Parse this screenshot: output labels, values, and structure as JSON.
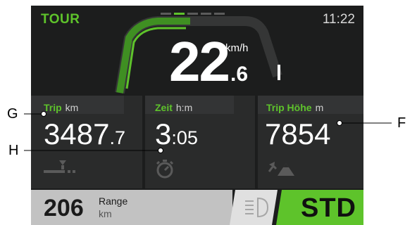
{
  "display": {
    "mode": "TOUR",
    "time": "11:22",
    "page_indicator": {
      "count": 5,
      "active_index": 1
    }
  },
  "speed": {
    "integer": "22",
    "decimal": ".6",
    "unit": "km/h"
  },
  "panels": {
    "trip": {
      "label": "Trip",
      "unit": "km",
      "value_main": "3487",
      "value_small": ".7",
      "icon": "road-distance-icon"
    },
    "time": {
      "label": "Zeit",
      "unit": "h:m",
      "value_main": "3",
      "value_small": ":05",
      "icon": "stopwatch-icon"
    },
    "elevation": {
      "label": "Trip Höhe",
      "unit": "m",
      "value_main": "7854",
      "value_small": "",
      "icon": "mountain-climb-icon"
    }
  },
  "bottom": {
    "range_value": "206",
    "range_label": "Range",
    "range_unit": "km",
    "light_icon": "headlight-icon",
    "assist_mode": "STD"
  },
  "callouts": {
    "g": "G",
    "h": "H",
    "f": "F"
  },
  "colors": {
    "accent": "#5ec32b",
    "background": "#1c1d1d",
    "panel": "#2a2b2b",
    "range_box": "#c2c2c2"
  }
}
